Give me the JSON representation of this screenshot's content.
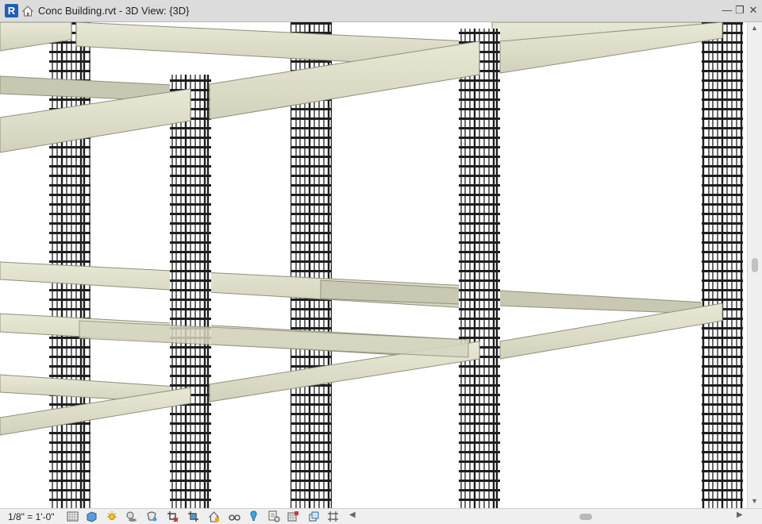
{
  "window": {
    "app_letter": "R",
    "title": "Conc Building.rvt - 3D View: {3D}",
    "minimize_glyph": "—",
    "restore_glyph": "❐",
    "close_glyph": "✕"
  },
  "statusbar": {
    "scale": "1/8\" = 1'-0\"",
    "icons": [
      "detail-level-icon",
      "visual-style-icon",
      "sun-path-icon",
      "shadows-icon",
      "rendering-icon",
      "crop-view-icon",
      "show-crop-region-icon",
      "unlock-view-icon",
      "temporary-hide-icon",
      "reveal-hidden-icon",
      "analytical-model-icon",
      "highlight-displacement-icon",
      "show-constraints-icon",
      "worksharing-display-icon"
    ]
  },
  "scrollbars": {
    "up": "▲",
    "down": "▼",
    "left": "◀",
    "right": "▶"
  },
  "colors": {
    "concrete": "#dcdcc6",
    "concrete_dark": "#a9a995",
    "rebar": "#1e1e1e",
    "chrome": "#dcdcdc"
  }
}
